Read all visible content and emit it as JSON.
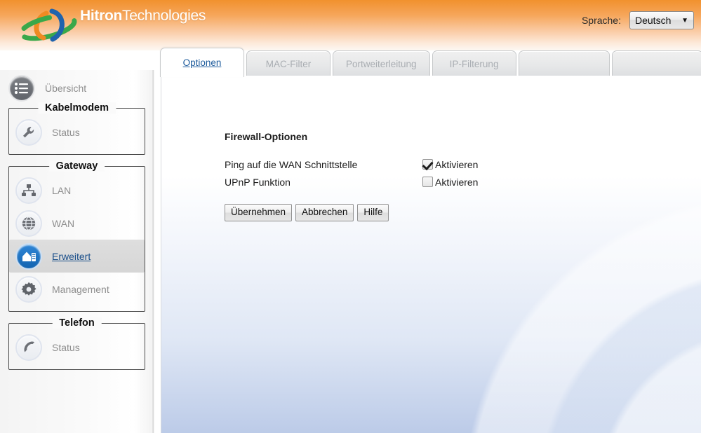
{
  "header": {
    "brand_bold": "Hitron",
    "brand_thin": "Technologies",
    "logo_icon": "hitron-swirl-logo",
    "language_label": "Sprache:",
    "language_value": "Deutsch",
    "language_caret": "▼",
    "gradient_top": "#f1912e",
    "gradient_bottom": "#fdf8f3"
  },
  "tabs": [
    {
      "label": "Optionen",
      "active": true,
      "name": "tab-optionen"
    },
    {
      "label": "MAC-Filter",
      "active": false,
      "name": "tab-mac-filter"
    },
    {
      "label": "Portweiterleitung",
      "active": false,
      "name": "tab-portweiterleitung"
    },
    {
      "label": "IP-Filterung",
      "active": false,
      "name": "tab-ip-filterung"
    },
    {
      "label": "",
      "active": false,
      "name": "tab-empty-1"
    },
    {
      "label": "",
      "active": false,
      "name": "tab-empty-2"
    }
  ],
  "sidebar": {
    "overview": {
      "label": "Übersicht",
      "icon": "list-lines-icon"
    },
    "groups": [
      {
        "legend": "Kabelmodem",
        "items": [
          {
            "label": "Status",
            "icon": "wrench-icon",
            "active": false
          }
        ]
      },
      {
        "legend": "Gateway",
        "items": [
          {
            "label": "LAN",
            "icon": "network-nodes-icon",
            "active": false
          },
          {
            "label": "WAN",
            "icon": "globe-icon",
            "active": false
          },
          {
            "label": "Erweitert",
            "icon": "advanced-house-icon",
            "active": true
          },
          {
            "label": "Management",
            "icon": "gear-icon",
            "active": false
          }
        ]
      },
      {
        "legend": "Telefon",
        "items": [
          {
            "label": "Status",
            "icon": "phone-handset-icon",
            "active": false
          }
        ]
      }
    ]
  },
  "main": {
    "section_title": "Firewall-Optionen",
    "options": [
      {
        "label": "Ping auf die WAN Schnittstelle",
        "checkbox_label": "Aktivieren",
        "checked": true
      },
      {
        "label": "UPnP Funktion",
        "checkbox_label": "Aktivieren",
        "checked": false
      }
    ],
    "buttons": [
      {
        "label": "Übernehmen",
        "name": "apply-button"
      },
      {
        "label": "Abbrechen",
        "name": "cancel-button"
      },
      {
        "label": "Hilfe",
        "name": "help-button"
      }
    ]
  },
  "colors": {
    "accent_orange": "#f1912e",
    "link_blue": "#1d5b9c",
    "active_icon_blue": "#1364b0",
    "panel_bottom_blue": "#bccbe8"
  }
}
